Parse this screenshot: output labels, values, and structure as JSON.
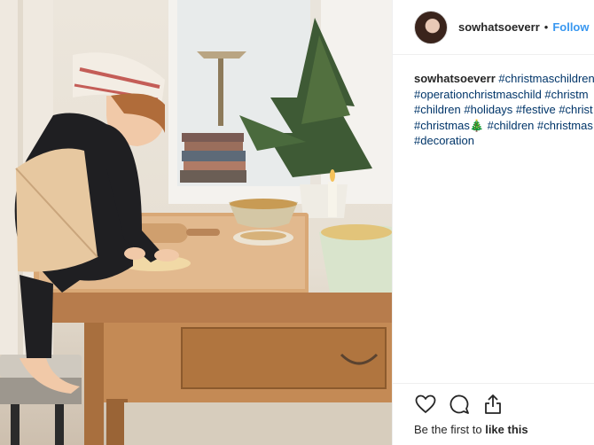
{
  "photo": {
    "icon": "photo-of-child-rolling-dough",
    "colors": {
      "wall": "#ece6dc",
      "table": "#b77c4c",
      "tree": "#3e5a35"
    }
  },
  "header": {
    "username": "sowhatsoeverr",
    "separator": "•",
    "follow_label": "Follow"
  },
  "caption": {
    "lines": [
      {
        "user": "sowhatsoeverr",
        "text": "#christmaschildren"
      },
      {
        "text": "#operationchristmaschild #christm"
      },
      {
        "text": "#children #holidays #festive #christ"
      },
      {
        "text": "#christmas🎄 #children #christmas"
      },
      {
        "text": "#decoration"
      }
    ]
  },
  "actions": {
    "like_icon": "heart-icon",
    "comment_icon": "comment-icon",
    "share_icon": "share-icon"
  },
  "likes": {
    "prefix": "Be the first to ",
    "bold": "like this"
  },
  "colors": {
    "link": "#3897f0",
    "hashtag": "#003569",
    "text": "#262626",
    "border": "#efefef"
  }
}
